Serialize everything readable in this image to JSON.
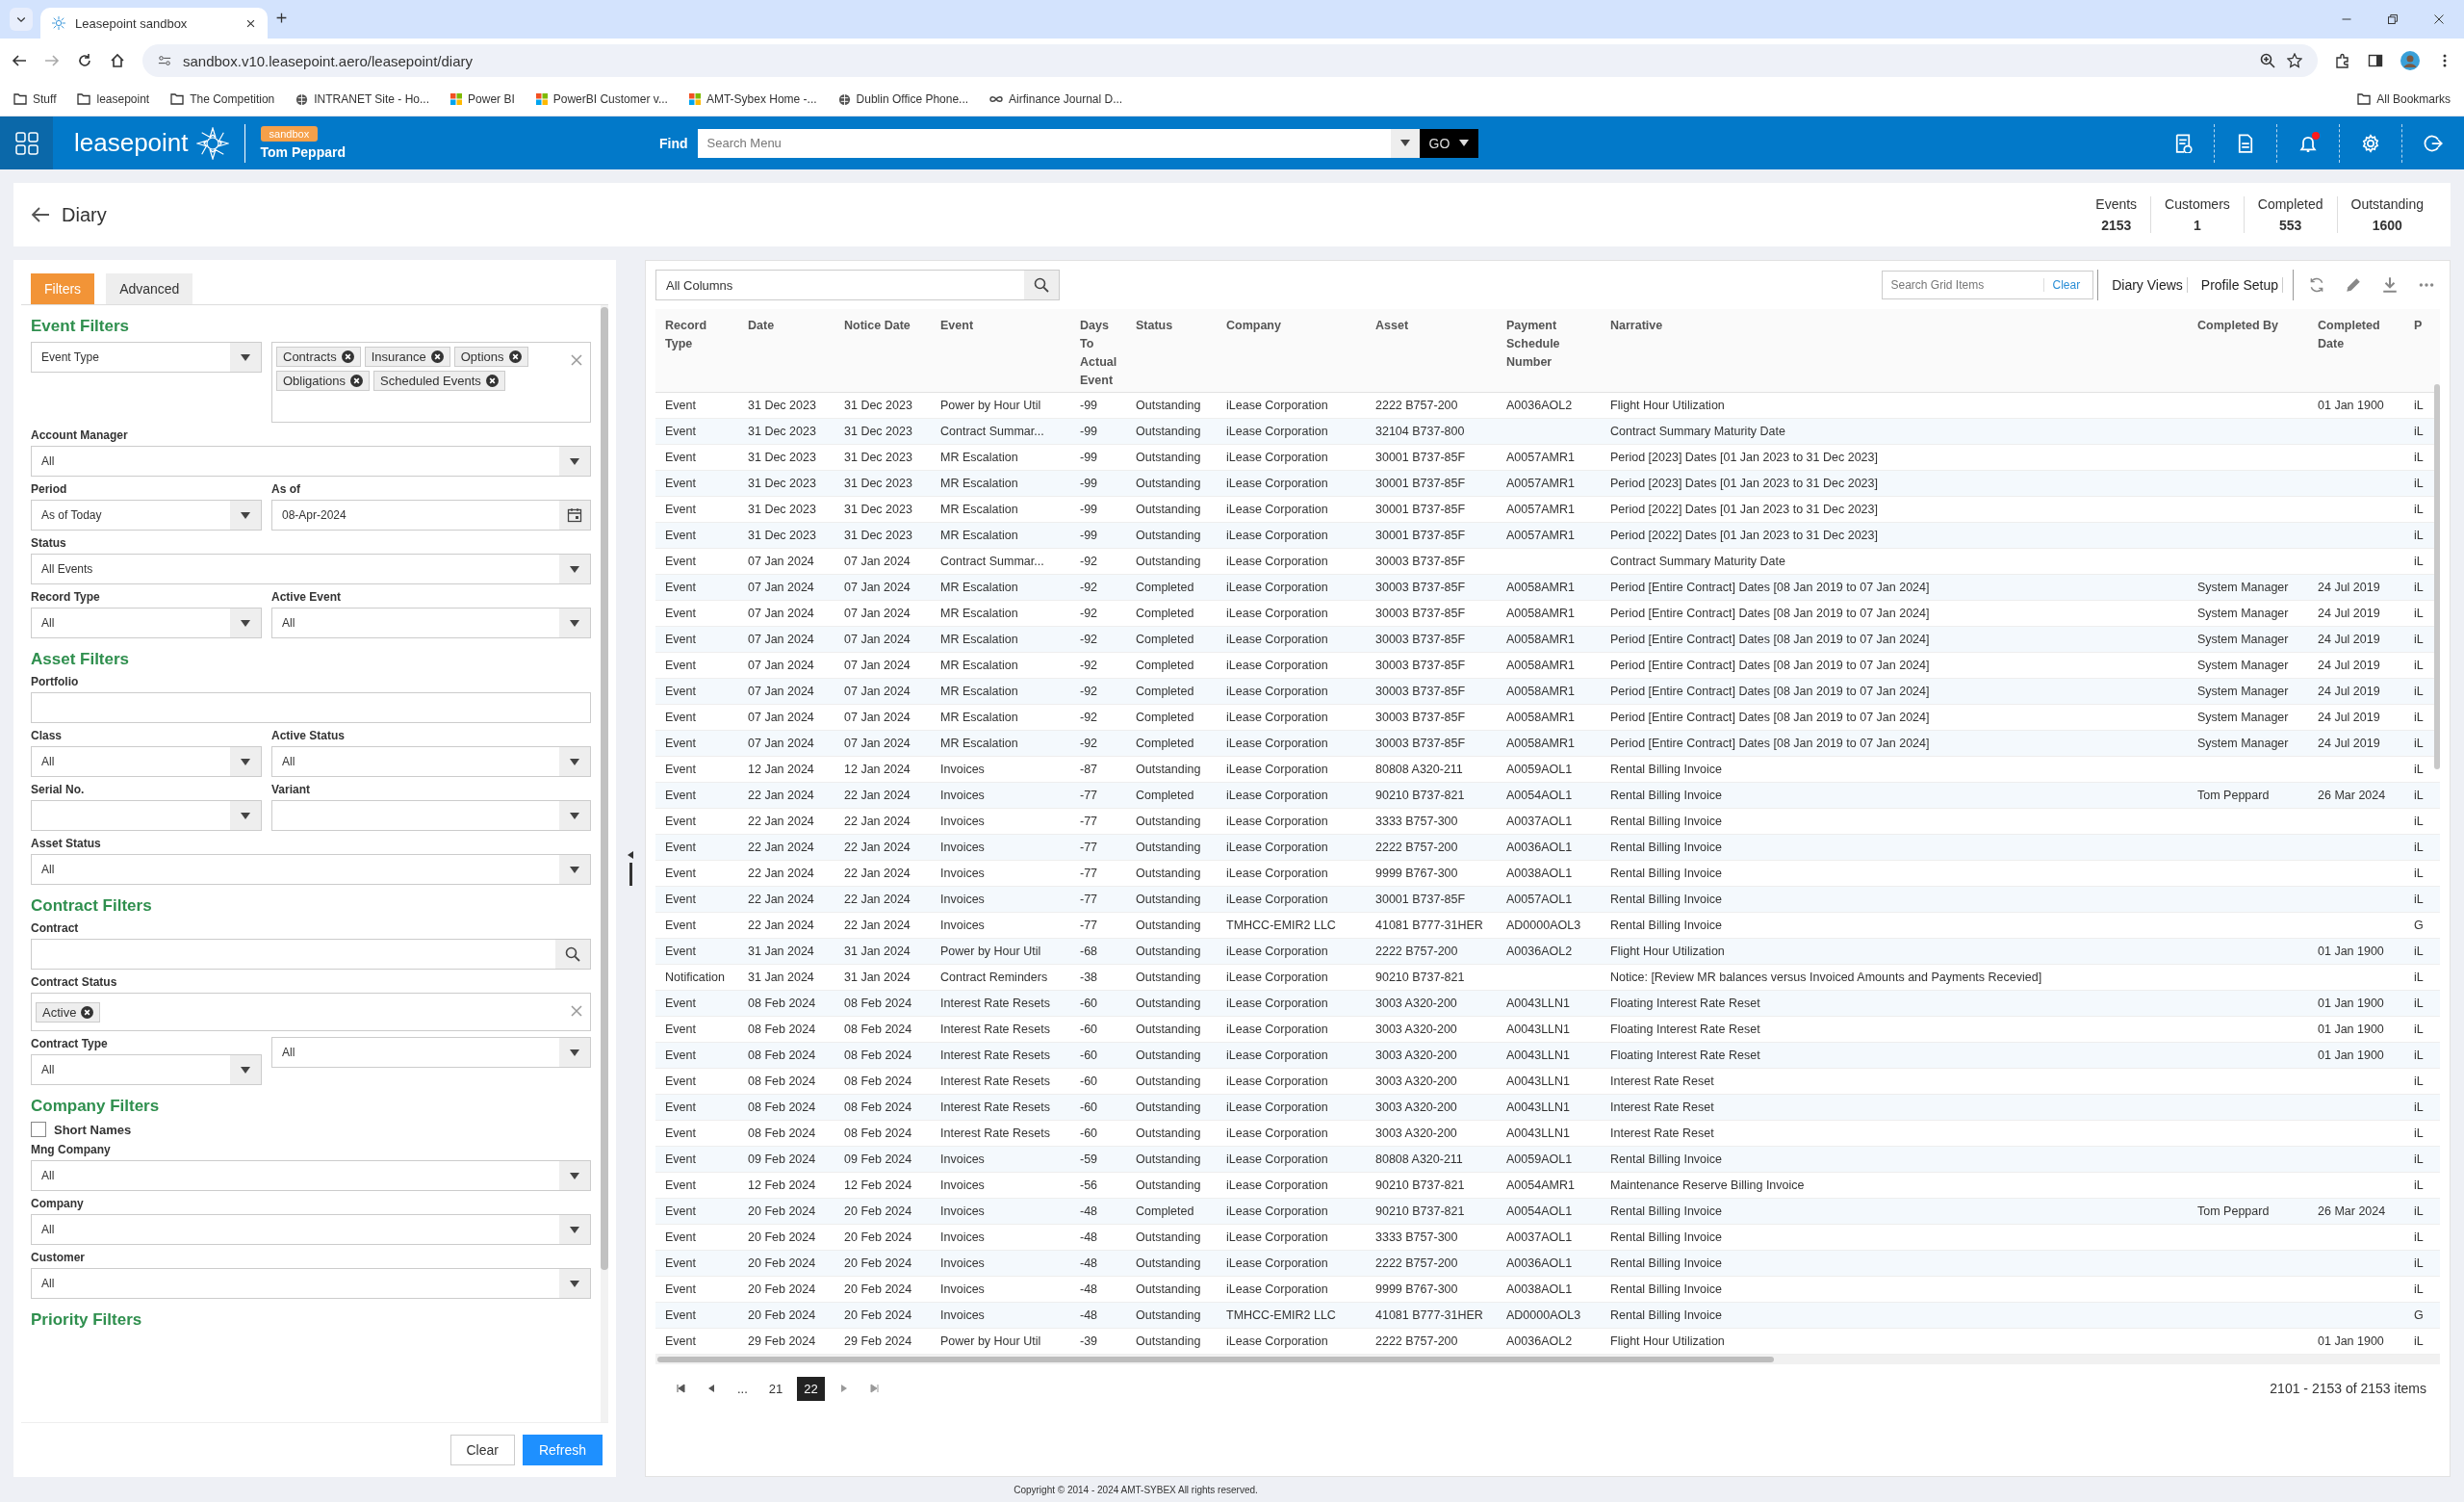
{
  "browser": {
    "tab_title": "Leasepoint sandbox",
    "url": "sandbox.v10.leasepoint.aero/leasepoint/diary",
    "bookmarks": [
      {
        "label": "Stuff",
        "kind": "folder"
      },
      {
        "label": "leasepoint",
        "kind": "folder"
      },
      {
        "label": "The Competition",
        "kind": "folder"
      },
      {
        "label": "INTRANET Site - Ho...",
        "kind": "globe"
      },
      {
        "label": "Power BI",
        "kind": "tiles"
      },
      {
        "label": "PowerBI Customer v...",
        "kind": "tiles"
      },
      {
        "label": "AMT-Sybex Home -...",
        "kind": "tiles"
      },
      {
        "label": "Dublin Office Phone...",
        "kind": "globe"
      },
      {
        "label": "Airfinance Journal D...",
        "kind": "link"
      }
    ],
    "all_bookmarks": "All Bookmarks"
  },
  "app_bar": {
    "logo": "leasepoint",
    "environment": "sandbox",
    "user": "Tom Peppard",
    "find_label": "Find",
    "search_placeholder": "Search Menu",
    "go": "GO",
    "notification_dot": true
  },
  "page": {
    "title": "Diary",
    "stats": [
      {
        "label": "Events",
        "value": "2153"
      },
      {
        "label": "Customers",
        "value": "1"
      },
      {
        "label": "Completed",
        "value": "553"
      },
      {
        "label": "Outstanding",
        "value": "1600"
      }
    ]
  },
  "filters": {
    "tabs": [
      {
        "label": "Filters",
        "selected": true
      },
      {
        "label": "Advanced",
        "selected": false
      }
    ],
    "sections": [
      {
        "title": "Event Filters",
        "rows": [
          [
            {
              "kind": "select",
              "value": "Event Type"
            },
            {
              "kind": "tags",
              "tags": [
                "Contracts",
                "Insurance",
                "Options",
                "Obligations",
                "Scheduled Events"
              ]
            }
          ],
          [
            {
              "kind": "select",
              "label": "Account Manager",
              "value": "All"
            }
          ],
          [
            {
              "kind": "select",
              "label": "Period",
              "value": "As of Today"
            },
            {
              "kind": "date",
              "label": "As of",
              "value": "08-Apr-2024"
            }
          ],
          [
            {
              "kind": "select",
              "label": "Status",
              "value": "All Events"
            }
          ],
          [
            {
              "kind": "select",
              "label": "Record Type",
              "value": "All"
            },
            {
              "kind": "select",
              "label": "Active Event",
              "value": "All"
            }
          ]
        ]
      },
      {
        "title": "Asset Filters",
        "rows": [
          [
            {
              "kind": "text",
              "label": "Portfolio"
            }
          ],
          [
            {
              "kind": "select",
              "label": "Class",
              "value": "All"
            },
            {
              "kind": "select",
              "label": "Active Status",
              "value": "All"
            }
          ],
          [
            {
              "kind": "select",
              "label": "Serial No."
            },
            {
              "kind": "select",
              "label": "Variant"
            }
          ],
          [
            {
              "kind": "select",
              "label": "Asset Status",
              "value": "All"
            }
          ]
        ]
      },
      {
        "title": "Contract Filters",
        "rows": [
          [
            {
              "kind": "search",
              "label": "Contract"
            }
          ],
          [
            {
              "kind": "tags",
              "label": "Contract Status",
              "tags": [
                "Active"
              ]
            }
          ],
          [
            {
              "kind": "select",
              "label": "Contract Type",
              "value": "All"
            },
            {
              "kind": "select",
              "value": "All"
            }
          ]
        ]
      },
      {
        "title": "Company Filters",
        "rows": [
          [
            {
              "kind": "checkbox",
              "label": "Short Names",
              "checked": false
            }
          ],
          [
            {
              "kind": "select",
              "label": "Mng Company",
              "value": "All"
            }
          ],
          [
            {
              "kind": "select",
              "label": "Company",
              "value": "All"
            }
          ],
          [
            {
              "kind": "select",
              "label": "Customer",
              "value": "All"
            }
          ]
        ]
      },
      {
        "title": "Priority Filters"
      }
    ],
    "buttons": [
      {
        "label": "Clear",
        "primary": false
      },
      {
        "label": "Refresh",
        "primary": true
      }
    ]
  },
  "grid": {
    "column_filter": "All Columns",
    "search_placeholder": "Search Grid Items",
    "clear": "Clear",
    "views": [
      "Diary Views",
      "Profile Setup"
    ],
    "columns": [
      "Record Type",
      "Date",
      "Notice Date",
      "Event",
      "Days To Actual Event",
      "Status",
      "Company",
      "Asset",
      "Payment Schedule Number",
      "Narrative",
      "Completed By",
      "Completed Date",
      "P"
    ],
    "rows": [
      [
        "Event",
        "31 Dec 2023",
        "31 Dec 2023",
        "Power by Hour Util",
        "-99",
        "Outstanding",
        "iLease Corporation",
        "2222 B757-200",
        "A0036AOL2",
        "Flight Hour Utilization",
        null,
        "01 Jan 1900",
        "iL"
      ],
      [
        "Event",
        "31 Dec 2023",
        "31 Dec 2023",
        "Contract Summar...",
        "-99",
        "Outstanding",
        "iLease Corporation",
        "32104 B737-800",
        null,
        "Contract Summary Maturity Date",
        null,
        null,
        "iL"
      ],
      [
        "Event",
        "31 Dec 2023",
        "31 Dec 2023",
        "MR Escalation",
        "-99",
        "Outstanding",
        "iLease Corporation",
        "30001 B737-85F",
        "A0057AMR1",
        "Period [2023] Dates [01 Jan 2023 to 31 Dec 2023]",
        null,
        null,
        "iL"
      ],
      [
        "Event",
        "31 Dec 2023",
        "31 Dec 2023",
        "MR Escalation",
        "-99",
        "Outstanding",
        "iLease Corporation",
        "30001 B737-85F",
        "A0057AMR1",
        "Period [2023] Dates [01 Jan 2023 to 31 Dec 2023]",
        null,
        null,
        "iL"
      ],
      [
        "Event",
        "31 Dec 2023",
        "31 Dec 2023",
        "MR Escalation",
        "-99",
        "Outstanding",
        "iLease Corporation",
        "30001 B737-85F",
        "A0057AMR1",
        "Period [2022] Dates [01 Jan 2023 to 31 Dec 2023]",
        null,
        null,
        "iL"
      ],
      [
        "Event",
        "31 Dec 2023",
        "31 Dec 2023",
        "MR Escalation",
        "-99",
        "Outstanding",
        "iLease Corporation",
        "30001 B737-85F",
        "A0057AMR1",
        "Period [2022] Dates [01 Jan 2023 to 31 Dec 2023]",
        null,
        null,
        "iL"
      ],
      [
        "Event",
        "07 Jan 2024",
        "07 Jan 2024",
        "Contract Summar...",
        "-92",
        "Outstanding",
        "iLease Corporation",
        "30003 B737-85F",
        null,
        "Contract Summary Maturity Date",
        null,
        null,
        "iL"
      ],
      [
        "Event",
        "07 Jan 2024",
        "07 Jan 2024",
        "MR Escalation",
        "-92",
        "Completed",
        "iLease Corporation",
        "30003 B737-85F",
        "A0058AMR1",
        "Period [Entire Contract] Dates [08 Jan 2019 to 07 Jan 2024]",
        "System Manager",
        "24 Jul 2019",
        "iL"
      ],
      [
        "Event",
        "07 Jan 2024",
        "07 Jan 2024",
        "MR Escalation",
        "-92",
        "Completed",
        "iLease Corporation",
        "30003 B737-85F",
        "A0058AMR1",
        "Period [Entire Contract] Dates [08 Jan 2019 to 07 Jan 2024]",
        "System Manager",
        "24 Jul 2019",
        "iL"
      ],
      [
        "Event",
        "07 Jan 2024",
        "07 Jan 2024",
        "MR Escalation",
        "-92",
        "Completed",
        "iLease Corporation",
        "30003 B737-85F",
        "A0058AMR1",
        "Period [Entire Contract] Dates [08 Jan 2019 to 07 Jan 2024]",
        "System Manager",
        "24 Jul 2019",
        "iL"
      ],
      [
        "Event",
        "07 Jan 2024",
        "07 Jan 2024",
        "MR Escalation",
        "-92",
        "Completed",
        "iLease Corporation",
        "30003 B737-85F",
        "A0058AMR1",
        "Period [Entire Contract] Dates [08 Jan 2019 to 07 Jan 2024]",
        "System Manager",
        "24 Jul 2019",
        "iL"
      ],
      [
        "Event",
        "07 Jan 2024",
        "07 Jan 2024",
        "MR Escalation",
        "-92",
        "Completed",
        "iLease Corporation",
        "30003 B737-85F",
        "A0058AMR1",
        "Period [Entire Contract] Dates [08 Jan 2019 to 07 Jan 2024]",
        "System Manager",
        "24 Jul 2019",
        "iL"
      ],
      [
        "Event",
        "07 Jan 2024",
        "07 Jan 2024",
        "MR Escalation",
        "-92",
        "Completed",
        "iLease Corporation",
        "30003 B737-85F",
        "A0058AMR1",
        "Period [Entire Contract] Dates [08 Jan 2019 to 07 Jan 2024]",
        "System Manager",
        "24 Jul 2019",
        "iL"
      ],
      [
        "Event",
        "07 Jan 2024",
        "07 Jan 2024",
        "MR Escalation",
        "-92",
        "Completed",
        "iLease Corporation",
        "30003 B737-85F",
        "A0058AMR1",
        "Period [Entire Contract] Dates [08 Jan 2019 to 07 Jan 2024]",
        "System Manager",
        "24 Jul 2019",
        "iL"
      ],
      [
        "Event",
        "12 Jan 2024",
        "12 Jan 2024",
        "Invoices",
        "-87",
        "Outstanding",
        "iLease Corporation",
        "80808 A320-211",
        "A0059AOL1",
        "Rental Billing Invoice",
        null,
        null,
        "iL"
      ],
      [
        "Event",
        "22 Jan 2024",
        "22 Jan 2024",
        "Invoices",
        "-77",
        "Completed",
        "iLease Corporation",
        "90210 B737-821",
        "A0054AOL1",
        "Rental Billing Invoice",
        "Tom Peppard",
        "26 Mar 2024",
        "iL"
      ],
      [
        "Event",
        "22 Jan 2024",
        "22 Jan 2024",
        "Invoices",
        "-77",
        "Outstanding",
        "iLease Corporation",
        "3333 B757-300",
        "A0037AOL1",
        "Rental Billing Invoice",
        null,
        null,
        "iL"
      ],
      [
        "Event",
        "22 Jan 2024",
        "22 Jan 2024",
        "Invoices",
        "-77",
        "Outstanding",
        "iLease Corporation",
        "2222 B757-200",
        "A0036AOL1",
        "Rental Billing Invoice",
        null,
        null,
        "iL"
      ],
      [
        "Event",
        "22 Jan 2024",
        "22 Jan 2024",
        "Invoices",
        "-77",
        "Outstanding",
        "iLease Corporation",
        "9999 B767-300",
        "A0038AOL1",
        "Rental Billing Invoice",
        null,
        null,
        "iL"
      ],
      [
        "Event",
        "22 Jan 2024",
        "22 Jan 2024",
        "Invoices",
        "-77",
        "Outstanding",
        "iLease Corporation",
        "30001 B737-85F",
        "A0057AOL1",
        "Rental Billing Invoice",
        null,
        null,
        "iL"
      ],
      [
        "Event",
        "22 Jan 2024",
        "22 Jan 2024",
        "Invoices",
        "-77",
        "Outstanding",
        "TMHCC-EMIR2 LLC",
        "41081 B777-31HER",
        "AD0000AOL3",
        "Rental Billing Invoice",
        null,
        null,
        "G"
      ],
      [
        "Event",
        "31 Jan 2024",
        "31 Jan 2024",
        "Power by Hour Util",
        "-68",
        "Outstanding",
        "iLease Corporation",
        "2222 B757-200",
        "A0036AOL2",
        "Flight Hour Utilization",
        null,
        "01 Jan 1900",
        "iL"
      ],
      [
        "Notification",
        "31 Jan 2024",
        "31 Jan 2024",
        "Contract Reminders",
        "-38",
        "Outstanding",
        "iLease Corporation",
        "90210 B737-821",
        null,
        "Notice: [Review MR balances versus Invoiced Amounts and Payments Recevied]",
        null,
        null,
        "iL"
      ],
      [
        "Event",
        "08 Feb 2024",
        "08 Feb 2024",
        "Interest Rate Resets",
        "-60",
        "Outstanding",
        "iLease Corporation",
        "3003 A320-200",
        "A0043LLN1",
        "Floating Interest Rate Reset",
        null,
        "01 Jan 1900",
        "iL"
      ],
      [
        "Event",
        "08 Feb 2024",
        "08 Feb 2024",
        "Interest Rate Resets",
        "-60",
        "Outstanding",
        "iLease Corporation",
        "3003 A320-200",
        "A0043LLN1",
        "Floating Interest Rate Reset",
        null,
        "01 Jan 1900",
        "iL"
      ],
      [
        "Event",
        "08 Feb 2024",
        "08 Feb 2024",
        "Interest Rate Resets",
        "-60",
        "Outstanding",
        "iLease Corporation",
        "3003 A320-200",
        "A0043LLN1",
        "Floating Interest Rate Reset",
        null,
        "01 Jan 1900",
        "iL"
      ],
      [
        "Event",
        "08 Feb 2024",
        "08 Feb 2024",
        "Interest Rate Resets",
        "-60",
        "Outstanding",
        "iLease Corporation",
        "3003 A320-200",
        "A0043LLN1",
        "Interest Rate Reset",
        null,
        null,
        "iL"
      ],
      [
        "Event",
        "08 Feb 2024",
        "08 Feb 2024",
        "Interest Rate Resets",
        "-60",
        "Outstanding",
        "iLease Corporation",
        "3003 A320-200",
        "A0043LLN1",
        "Interest Rate Reset",
        null,
        null,
        "iL"
      ],
      [
        "Event",
        "08 Feb 2024",
        "08 Feb 2024",
        "Interest Rate Resets",
        "-60",
        "Outstanding",
        "iLease Corporation",
        "3003 A320-200",
        "A0043LLN1",
        "Interest Rate Reset",
        null,
        null,
        "iL"
      ],
      [
        "Event",
        "09 Feb 2024",
        "09 Feb 2024",
        "Invoices",
        "-59",
        "Outstanding",
        "iLease Corporation",
        "80808 A320-211",
        "A0059AOL1",
        "Rental Billing Invoice",
        null,
        null,
        "iL"
      ],
      [
        "Event",
        "12 Feb 2024",
        "12 Feb 2024",
        "Invoices",
        "-56",
        "Outstanding",
        "iLease Corporation",
        "90210 B737-821",
        "A0054AMR1",
        "Maintenance Reserve Billing Invoice",
        null,
        null,
        "iL"
      ],
      [
        "Event",
        "20 Feb 2024",
        "20 Feb 2024",
        "Invoices",
        "-48",
        "Completed",
        "iLease Corporation",
        "90210 B737-821",
        "A0054AOL1",
        "Rental Billing Invoice",
        "Tom Peppard",
        "26 Mar 2024",
        "iL"
      ],
      [
        "Event",
        "20 Feb 2024",
        "20 Feb 2024",
        "Invoices",
        "-48",
        "Outstanding",
        "iLease Corporation",
        "3333 B757-300",
        "A0037AOL1",
        "Rental Billing Invoice",
        null,
        null,
        "iL"
      ],
      [
        "Event",
        "20 Feb 2024",
        "20 Feb 2024",
        "Invoices",
        "-48",
        "Outstanding",
        "iLease Corporation",
        "2222 B757-200",
        "A0036AOL1",
        "Rental Billing Invoice",
        null,
        null,
        "iL"
      ],
      [
        "Event",
        "20 Feb 2024",
        "20 Feb 2024",
        "Invoices",
        "-48",
        "Outstanding",
        "iLease Corporation",
        "9999 B767-300",
        "A0038AOL1",
        "Rental Billing Invoice",
        null,
        null,
        "iL"
      ],
      [
        "Event",
        "20 Feb 2024",
        "20 Feb 2024",
        "Invoices",
        "-48",
        "Outstanding",
        "TMHCC-EMIR2 LLC",
        "41081 B777-31HER",
        "AD0000AOL3",
        "Rental Billing Invoice",
        null,
        null,
        "G"
      ],
      [
        "Event",
        "29 Feb 2024",
        "29 Feb 2024",
        "Power by Hour Util",
        "-39",
        "Outstanding",
        "iLease Corporation",
        "2222 B757-200",
        "A0036AOL2",
        "Flight Hour Utilization",
        null,
        "01 Jan 1900",
        "iL"
      ]
    ],
    "pager": {
      "ellipsis": "...",
      "pages": [
        {
          "label": "21",
          "selected": false
        },
        {
          "label": "22",
          "selected": true
        }
      ],
      "info": "2101 - 2153 of 2153 items"
    }
  },
  "footer": "Copyright © 2014 - 2024 AMT-SYBEX All rights reserved."
}
